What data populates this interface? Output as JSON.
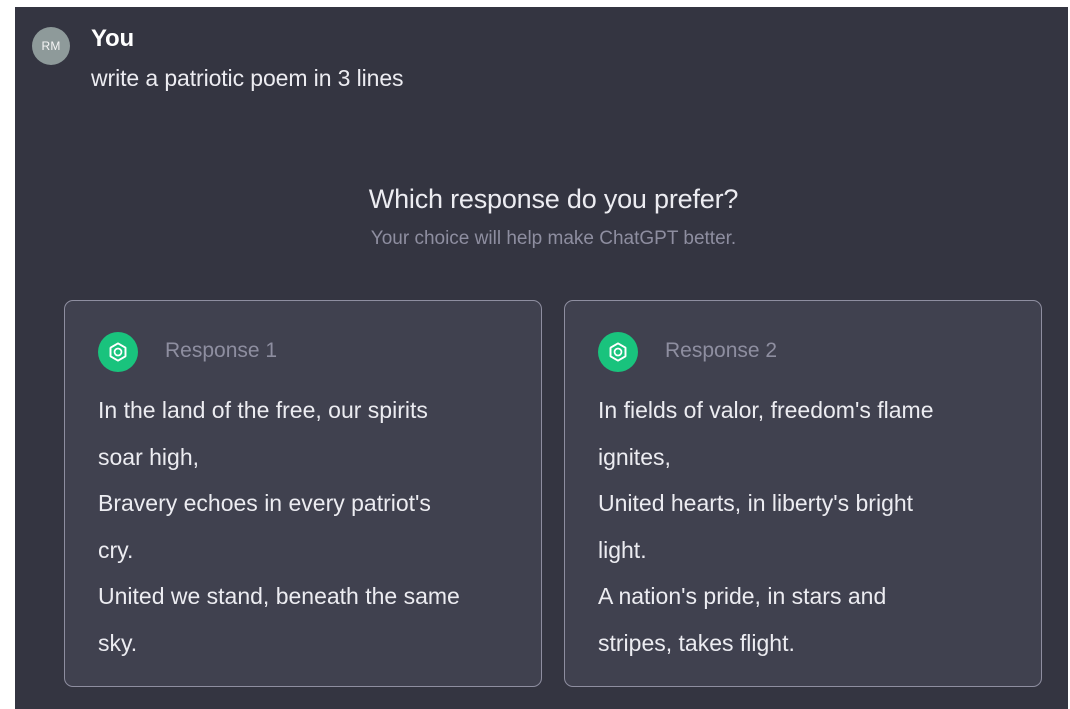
{
  "user": {
    "initials": "RM",
    "name": "You",
    "message": "write a patriotic poem in 3 lines"
  },
  "prompt": {
    "title": "Which response do you prefer?",
    "subtitle": "Your choice will help make ChatGPT better."
  },
  "responses": [
    {
      "label": "Response 1",
      "lines": [
        "In the land of the free, our spirits",
        "soar high,",
        "Bravery echoes in every patriot's",
        "cry.",
        "United we stand, beneath the same",
        "sky."
      ]
    },
    {
      "label": "Response 2",
      "lines": [
        "In fields of valor, freedom's flame",
        "ignites,",
        "United hearts, in liberty's bright",
        "light.",
        "A nation's pride, in stars and",
        "stripes, takes flight."
      ]
    }
  ],
  "icons": {
    "assistant": "openai-logo-icon"
  },
  "colors": {
    "background": "#343541",
    "card": "#40414f",
    "accent": "#19c37d",
    "muted_text": "#8e8ea0",
    "avatar": "#8e9a9a"
  }
}
